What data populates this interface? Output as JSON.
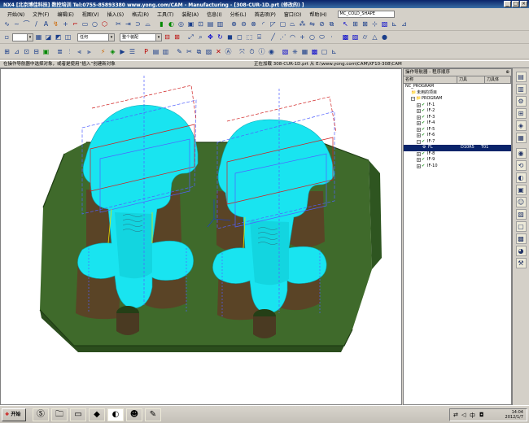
{
  "window": {
    "title": "NX4  [北京博佳科技] 数控培训 Tel:0755-85893380 www.yong.com/CAM - Manufacturing - [308-CUR-1D.prt (修改的) ]"
  },
  "menubar": {
    "items": [
      "开始(N)",
      "文件(F)",
      "编辑(E)",
      "视图(V)",
      "插入(S)",
      "格式(R)",
      "工具(T)",
      "装配(A)",
      "信息(I)",
      "分析(L)",
      "首选项(P)",
      "窗口(O)",
      "帮助(H)"
    ],
    "app_combo": "MC_COLD_SHAPE"
  },
  "toolbar2": {
    "filter_combo": "任何",
    "assembly_combo": "整个装配"
  },
  "cuebar": {
    "cue": "在操作导航器中选择对象，或者是使用“插入”创建新对象",
    "status": "正在加载 308-CUR-1D.prt 从 E:\\www.yong.com\\CAM\\XF10-308\\CAM"
  },
  "navigator": {
    "title": "操作导航器 - 程序顺序",
    "columns": [
      "名称",
      "刀具",
      "刀具体"
    ],
    "rows": [
      {
        "label": "NC_PROGRAM",
        "indent": 0,
        "exp": "",
        "icon": ""
      },
      {
        "label": "未用的项目",
        "indent": 1,
        "exp": "",
        "icon": "📁"
      },
      {
        "label": "PROGRAM",
        "indent": 1,
        "exp": "−",
        "icon": "📁"
      },
      {
        "label": "IF-1",
        "indent": 2,
        "exp": "+",
        "icon": "✔"
      },
      {
        "label": "IF-2",
        "indent": 2,
        "exp": "+",
        "icon": "✔"
      },
      {
        "label": "IF-3",
        "indent": 2,
        "exp": "+",
        "icon": "✔"
      },
      {
        "label": "IF-4",
        "indent": 2,
        "exp": "+",
        "icon": "✔"
      },
      {
        "label": "IF-5",
        "indent": 2,
        "exp": "+",
        "icon": "✔"
      },
      {
        "label": "IF-6",
        "indent": 2,
        "exp": "+",
        "icon": "✔"
      },
      {
        "label": "IF-7",
        "indent": 2,
        "exp": "−",
        "icon": "✔"
      },
      {
        "label": "FL",
        "indent": 3,
        "exp": "",
        "icon": "⚙",
        "tool": "D10R5",
        "body": "T01",
        "selected": true
      },
      {
        "label": "IF-8",
        "indent": 2,
        "exp": "+",
        "icon": "✔"
      },
      {
        "label": "IF-9",
        "indent": 2,
        "exp": "+",
        "icon": "✔"
      },
      {
        "label": "IF-10",
        "indent": 2,
        "exp": "+",
        "icon": "✔"
      }
    ]
  },
  "taskbar": {
    "start_label": "开始",
    "time": "14:04",
    "date": "2012/1/7"
  },
  "colors": {
    "block_green": "#3f6a2b",
    "surface_cyan": "#19e4f0",
    "selection": "#0a246a"
  }
}
